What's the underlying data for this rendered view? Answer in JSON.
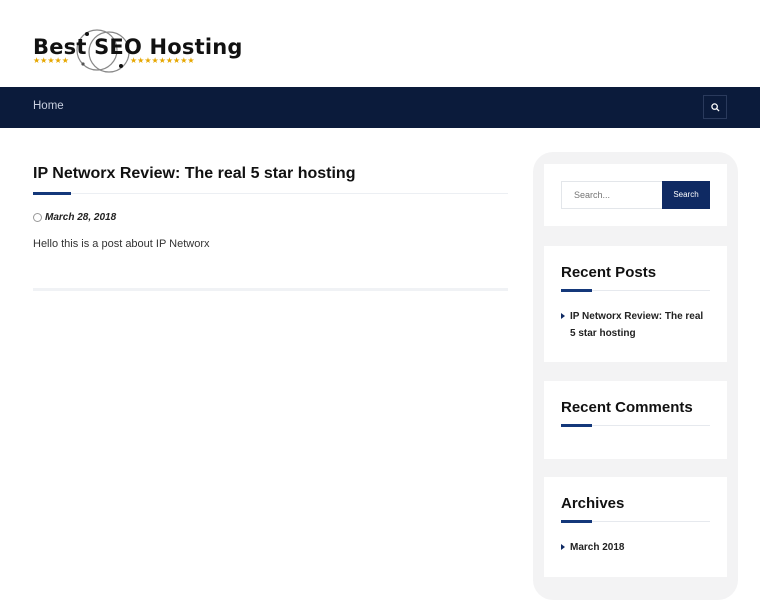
{
  "site": {
    "logo_text": "Best SEO Hosting",
    "logo_stars_left": "★★★★★",
    "logo_stars_right": "★★★★★★★★★"
  },
  "nav": {
    "home_label": "Home",
    "search_icon": "search-icon"
  },
  "post": {
    "title": "IP Networx Review: The real 5 star hosting",
    "date": "March 28, 2018",
    "body": "Hello this is a post about IP Networx"
  },
  "sidebar": {
    "search": {
      "placeholder": "Search...",
      "button_label": "Search"
    },
    "recent_posts": {
      "title": "Recent Posts",
      "items": [
        "IP Networx Review: The real 5 star hosting"
      ]
    },
    "recent_comments": {
      "title": "Recent Comments"
    },
    "archives": {
      "title": "Archives",
      "items": [
        "March 2018"
      ]
    }
  },
  "colors": {
    "nav_bg": "#0b1b3b",
    "accent": "#14387a",
    "button": "#0f2a63"
  }
}
